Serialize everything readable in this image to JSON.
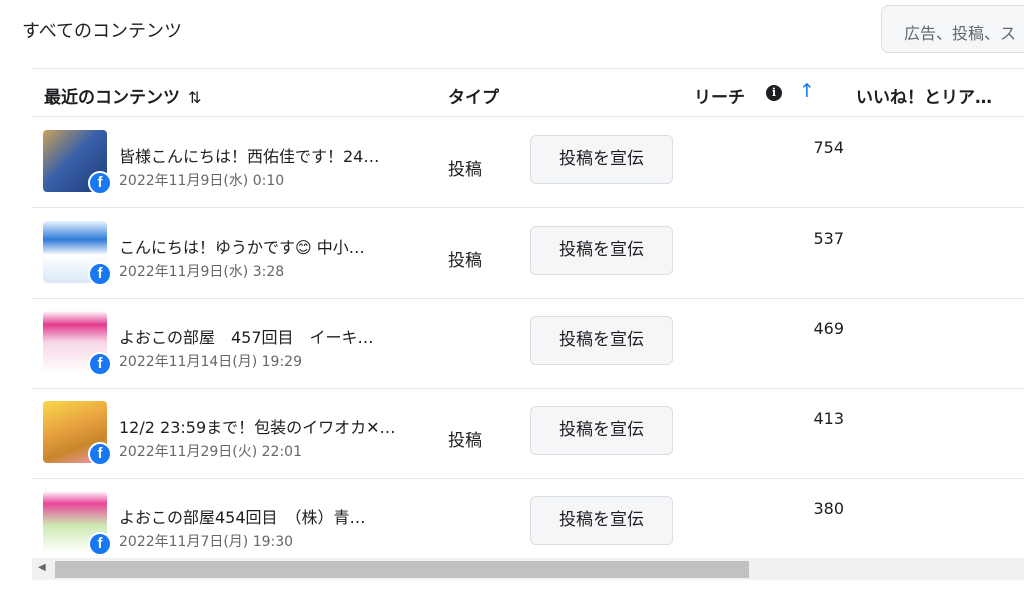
{
  "section": {
    "title": "すべてのコンテンツ"
  },
  "search": {
    "placeholder": "広告、投稿、ス"
  },
  "table": {
    "headers": {
      "content": "最近のコンテンツ",
      "content_sort": "⇅",
      "type": "タイプ",
      "reach": "リーチ",
      "reach_sort": "↑",
      "likes": "いいね！とリア…"
    },
    "rows": [
      {
        "title": "皆様こんにちは！西佑佳です！24…",
        "date": "2022年11月9日(水) 0:10",
        "type": "投稿",
        "button": "投稿を宣伝",
        "reach": "754"
      },
      {
        "title": "こんにちは！ゆうかです😊 中小…",
        "date": "2022年11月9日(水) 3:28",
        "type": "投稿",
        "button": "投稿を宣伝",
        "reach": "537"
      },
      {
        "title": "よおこの部屋　457回目　イーキ…",
        "date": "2022年11月14日(月) 19:29",
        "type": "",
        "button": "投稿を宣伝",
        "reach": "469"
      },
      {
        "title": "12/2 23:59まで！包装のイワオカ✕…",
        "date": "2022年11月29日(火) 22:01",
        "type": "投稿",
        "button": "投稿を宣伝",
        "reach": "413"
      },
      {
        "title": "よおこの部屋454回目　（株）青…",
        "date": "2022年11月7日(月) 19:30",
        "type": "",
        "button": "投稿を宣伝",
        "reach": "380"
      }
    ]
  },
  "icons": {
    "facebook": "facebook-icon",
    "info": "info-icon",
    "sort": "sort-icon"
  },
  "colors": {
    "accent": "#1877f2",
    "button_bg": "#f5f6f7",
    "border": "#e4e6eb"
  }
}
